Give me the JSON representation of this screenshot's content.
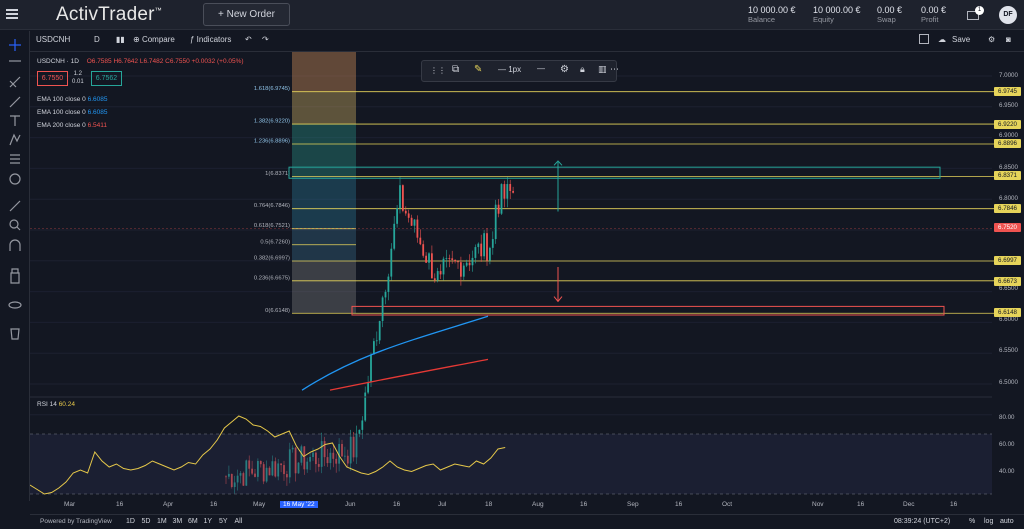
{
  "app": {
    "brand": "ActivTrader",
    "brand_mark": "™",
    "new_order_label": "+ New Order"
  },
  "account": {
    "balance": {
      "value": "10 000.00 €",
      "label": "Balance"
    },
    "equity": {
      "value": "10 000.00 €",
      "label": "Equity"
    },
    "swap": {
      "value": "0.00 €",
      "label": "Swap"
    },
    "profit": {
      "value": "0.00 €",
      "label": "Profit"
    },
    "notifications": "1",
    "avatar": "DF"
  },
  "toolbar": {
    "symbol": "USDCNH",
    "interval": "D",
    "compare_label": "Compare",
    "indicators_label": "Indicators",
    "save_label": "Save"
  },
  "legend": {
    "title": "USDCNH · 1D",
    "ohlc": "O6.7585  H6.7642  L6.7482  C6.7550  +0.0032 (+0.05%)",
    "bid": "6.7550",
    "spread_top": "1.2",
    "spread_bottom": "0.01",
    "ask": "6.7562",
    "ema1": {
      "label": "EMA 100 close 0",
      "value": "6.6085"
    },
    "ema2": {
      "label": "EMA 100 close 0",
      "value": "6.6085"
    },
    "ema3": {
      "label": "EMA 200 close 0",
      "value": "6.5411"
    }
  },
  "drawing_toolbar": {
    "width_label": "1px"
  },
  "fib_labels": [
    "1.618(6.9745)",
    "1.382(6.9220)",
    "1.236(6.8896)",
    "1(6.8371)",
    "0.764(6.7846)",
    "0.618(6.7521)",
    "0.5(6.7260)",
    "0.382(6.6997)",
    "0.236(6.6675)",
    "0(6.6148)"
  ],
  "price_axis": [
    "7.0000",
    "6.9500",
    "6.9000",
    "6.8500",
    "6.8000",
    "6.7500",
    "6.6500",
    "6.6000",
    "6.5500",
    "6.5000"
  ],
  "price_labels": [
    "6.9745",
    "6.9220",
    "6.8896",
    "6.8371",
    "6.7846",
    "6.7520",
    "6.6997",
    "6.6673",
    "6.6148"
  ],
  "rsi": {
    "label": "RSI 14",
    "value": "60.24",
    "axis": [
      "80.00",
      "60.00",
      "40.00"
    ]
  },
  "time_axis": [
    "Mar",
    "16",
    "Apr",
    "16",
    "May",
    "16 May '22",
    "Jun",
    "16",
    "Jul",
    "18",
    "Aug",
    "16",
    "Sep",
    "16",
    "Oct",
    "Nov",
    "16",
    "Dec",
    "16"
  ],
  "bottom": {
    "powered_by": "Powered by TradingView",
    "ranges": [
      "1D",
      "5D",
      "1M",
      "3M",
      "6M",
      "1Y",
      "5Y",
      "All"
    ],
    "clock": "08:39:24 (UTC+2)",
    "percent": "%",
    "log": "log",
    "auto": "auto"
  },
  "colors": {
    "up": "#26a69a",
    "down": "#ef5350",
    "fib_line": "#e6d45a",
    "ema_blue": "#2196f3",
    "ema_red": "#e53935",
    "rsi_line": "#e6c84a"
  }
}
